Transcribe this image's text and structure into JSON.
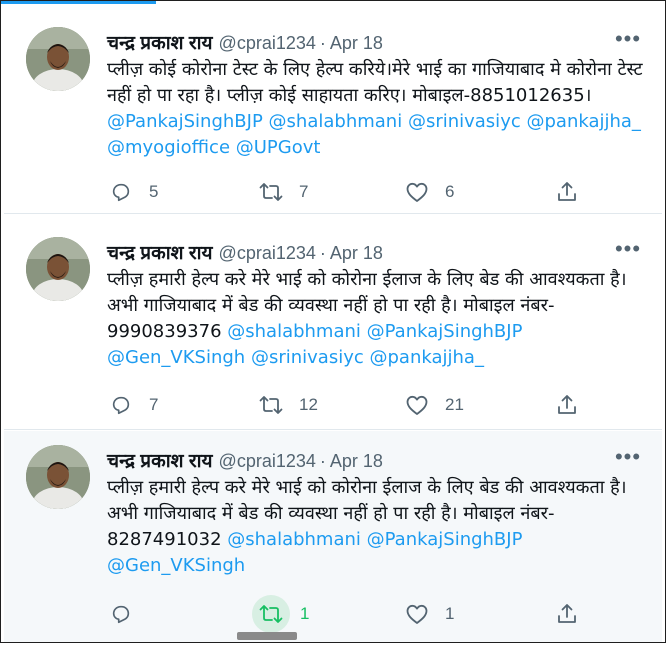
{
  "colors": {
    "accent": "#1d9bf0",
    "retweet_active": "#17bf63",
    "muted": "#536471"
  },
  "tweets": [
    {
      "name": "चन्द्र प्रकाश राय",
      "handle": "@cprai1234",
      "dot": "·",
      "date": "Apr 18",
      "text_plain": "प्लीज़ कोई कोरोना टेस्ट के लिए हेल्प करिये।मेरे भाई का गाजियाबाद मे कोरोना टेस्ट नहीं हो पा रहा है। प्लीज़ कोई साहायता करिए। मोबाइल-8851012635। ",
      "mentions": [
        "@PankajSinghBJP",
        "@shalabhmani",
        "@srinivasiyc",
        "@pankajjha_",
        "@myogioffice",
        "@UPGovt"
      ],
      "reply_count": "5",
      "retweet_count": "7",
      "like_count": "6",
      "retweeted": false
    },
    {
      "name": "चन्द्र प्रकाश राय",
      "handle": "@cprai1234",
      "dot": "·",
      "date": "Apr 18",
      "text_plain": "प्लीज़ हमारी हेल्प करे मेरे भाई को कोरोना ईलाज के लिए बेड की आवश्यकता है।अभी गाजियाबाद में बेड की व्यवस्था नहीं हो पा रही है। मोबाइल नंबर- 9990839376 ",
      "mentions": [
        "@shalabhmani",
        "@PankajSinghBJP",
        "@Gen_VKSingh",
        "@srinivasiyc",
        "@pankajjha_"
      ],
      "reply_count": "7",
      "retweet_count": "12",
      "like_count": "21",
      "retweeted": false
    },
    {
      "name": "चन्द्र प्रकाश राय",
      "handle": "@cprai1234",
      "dot": "·",
      "date": "Apr 18",
      "text_plain": "प्लीज़ हमारी हेल्प करे मेरे भाई को कोरोना ईलाज के लिए बेड की आवश्यकता है।अभी गाजियाबाद में बेड की व्यवस्था नहीं हो पा रही है। मोबाइल नंबर- 8287491032 ",
      "mentions": [
        "@shalabhmani",
        "@PankajSinghBJP",
        "@Gen_VKSingh"
      ],
      "reply_count": "",
      "retweet_count": "1",
      "like_count": "1",
      "retweeted": true
    }
  ],
  "icons": {
    "reply": "reply-icon",
    "retweet": "retweet-icon",
    "like": "like-icon",
    "share": "share-icon",
    "more": "more-icon"
  },
  "more_glyph": "•••"
}
